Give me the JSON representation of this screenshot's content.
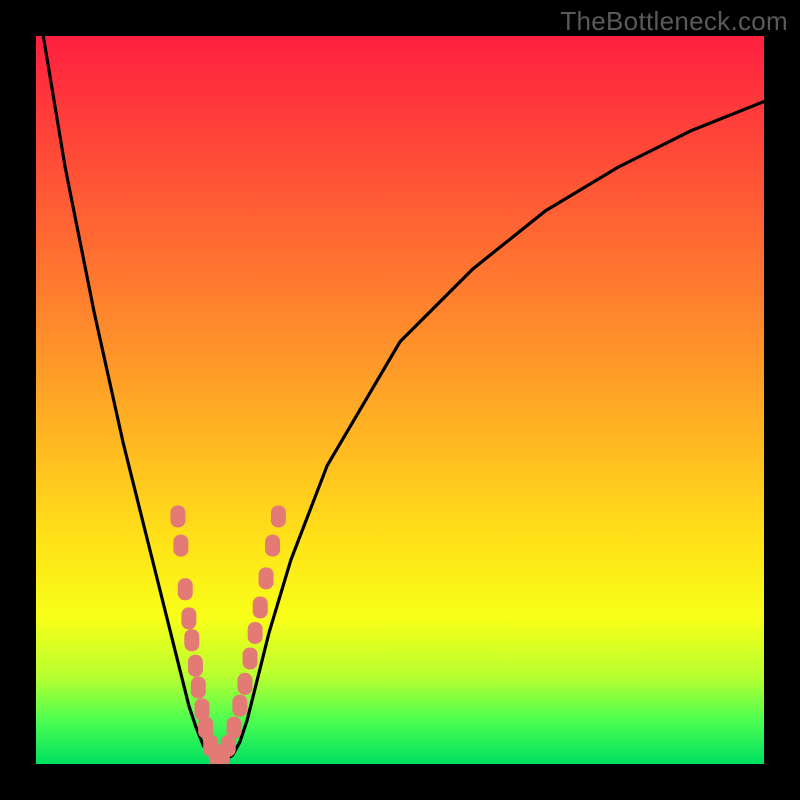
{
  "watermark": "TheBottleneck.com",
  "chart_data": {
    "type": "line",
    "title": "",
    "xlabel": "",
    "ylabel": "",
    "xlim": [
      0,
      100
    ],
    "ylim": [
      0,
      100
    ],
    "grid": false,
    "legend": false,
    "series": [
      {
        "name": "bottleneck-curve",
        "x": [
          1,
          4,
          8,
          12,
          16,
          18,
          20,
          21,
          22,
          23,
          24,
          25,
          26,
          27,
          28,
          29,
          30,
          32,
          35,
          40,
          50,
          60,
          70,
          80,
          90,
          100
        ],
        "y": [
          100,
          82,
          62,
          44,
          28,
          20,
          12,
          8,
          5,
          2.5,
          1.2,
          0.6,
          0.6,
          1.2,
          3,
          6,
          10,
          18,
          28,
          41,
          58,
          68,
          76,
          82,
          87,
          91
        ]
      }
    ],
    "highlight_points": {
      "name": "marker-cluster",
      "color": "#e47a75",
      "points": [
        {
          "x": 19.5,
          "y": 34
        },
        {
          "x": 19.9,
          "y": 30
        },
        {
          "x": 20.5,
          "y": 24
        },
        {
          "x": 21.0,
          "y": 20
        },
        {
          "x": 21.4,
          "y": 17
        },
        {
          "x": 21.9,
          "y": 13.5
        },
        {
          "x": 22.3,
          "y": 10.5
        },
        {
          "x": 22.8,
          "y": 7.5
        },
        {
          "x": 23.3,
          "y": 5
        },
        {
          "x": 24.0,
          "y": 2.5
        },
        {
          "x": 24.8,
          "y": 1.2
        },
        {
          "x": 25.6,
          "y": 1.2
        },
        {
          "x": 26.4,
          "y": 2.5
        },
        {
          "x": 27.2,
          "y": 5
        },
        {
          "x": 28.0,
          "y": 8
        },
        {
          "x": 28.7,
          "y": 11
        },
        {
          "x": 29.4,
          "y": 14.5
        },
        {
          "x": 30.1,
          "y": 18
        },
        {
          "x": 30.8,
          "y": 21.5
        },
        {
          "x": 31.6,
          "y": 25.5
        },
        {
          "x": 32.5,
          "y": 30
        },
        {
          "x": 33.3,
          "y": 34
        }
      ]
    }
  }
}
